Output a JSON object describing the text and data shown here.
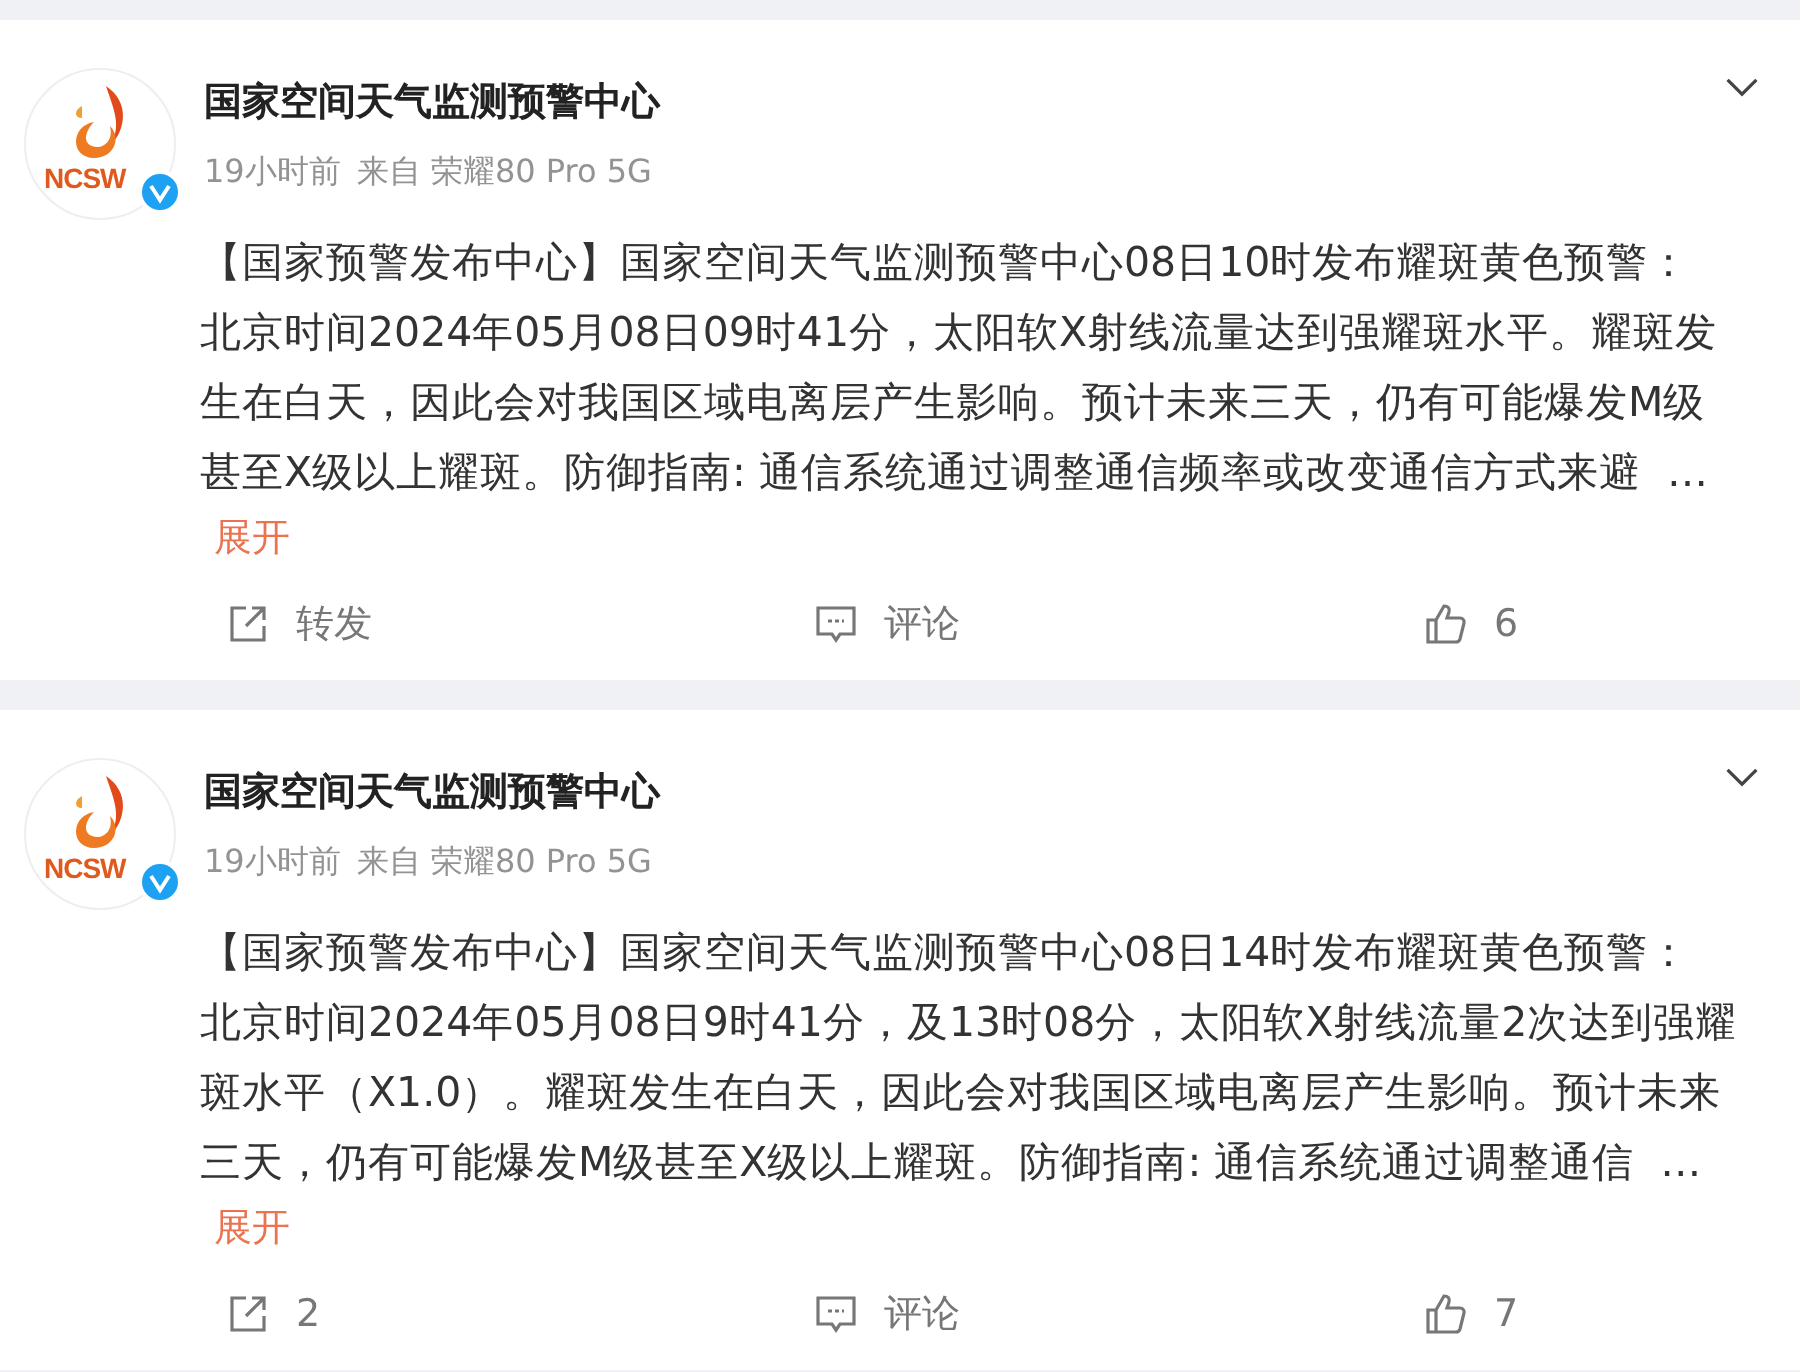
{
  "posts": [
    {
      "author": "国家空间天气监测预警中心",
      "avatar_text": "NCSW",
      "verified": true,
      "time": "19小时前",
      "source": "来自 荣耀80 Pro 5G",
      "lines": [
        "【国家预警发布中心】国家空间天气监测预警中心08日10时发布耀斑黄色预警：",
        "北京时间2024年05月08日09时41分，太阳软X射线流量达到强耀斑水平。耀斑发",
        "生在白天，因此会对我国区域电离层产生影响。预计未来三天，仍有可能爆发M级",
        "甚至X级以上耀斑。防御指南: 通信系统通过调整通信频率或改变通信方式来避  …"
      ],
      "expand": "展开",
      "actions": [
        {
          "kind": "share",
          "label": "转发"
        },
        {
          "kind": "comment",
          "label": "评论"
        },
        {
          "kind": "like",
          "label": "6"
        }
      ]
    },
    {
      "author": "国家空间天气监测预警中心",
      "avatar_text": "NCSW",
      "verified": true,
      "time": "19小时前",
      "source": "来自 荣耀80 Pro 5G",
      "lines": [
        "【国家预警发布中心】国家空间天气监测预警中心08日14时发布耀斑黄色预警：",
        "北京时间2024年05月08日9时41分，及13时08分，太阳软X射线流量2次达到强耀",
        "斑水平（X1.0）。耀斑发生在白天，因此会对我国区域电离层产生影响。预计未来",
        "三天，仍有可能爆发M级甚至X级以上耀斑。防御指南: 通信系统通过调整通信  …"
      ],
      "expand": "展开",
      "actions": [
        {
          "kind": "share",
          "label": "2"
        },
        {
          "kind": "comment",
          "label": "评论"
        },
        {
          "kind": "like",
          "label": "7"
        }
      ]
    }
  ]
}
